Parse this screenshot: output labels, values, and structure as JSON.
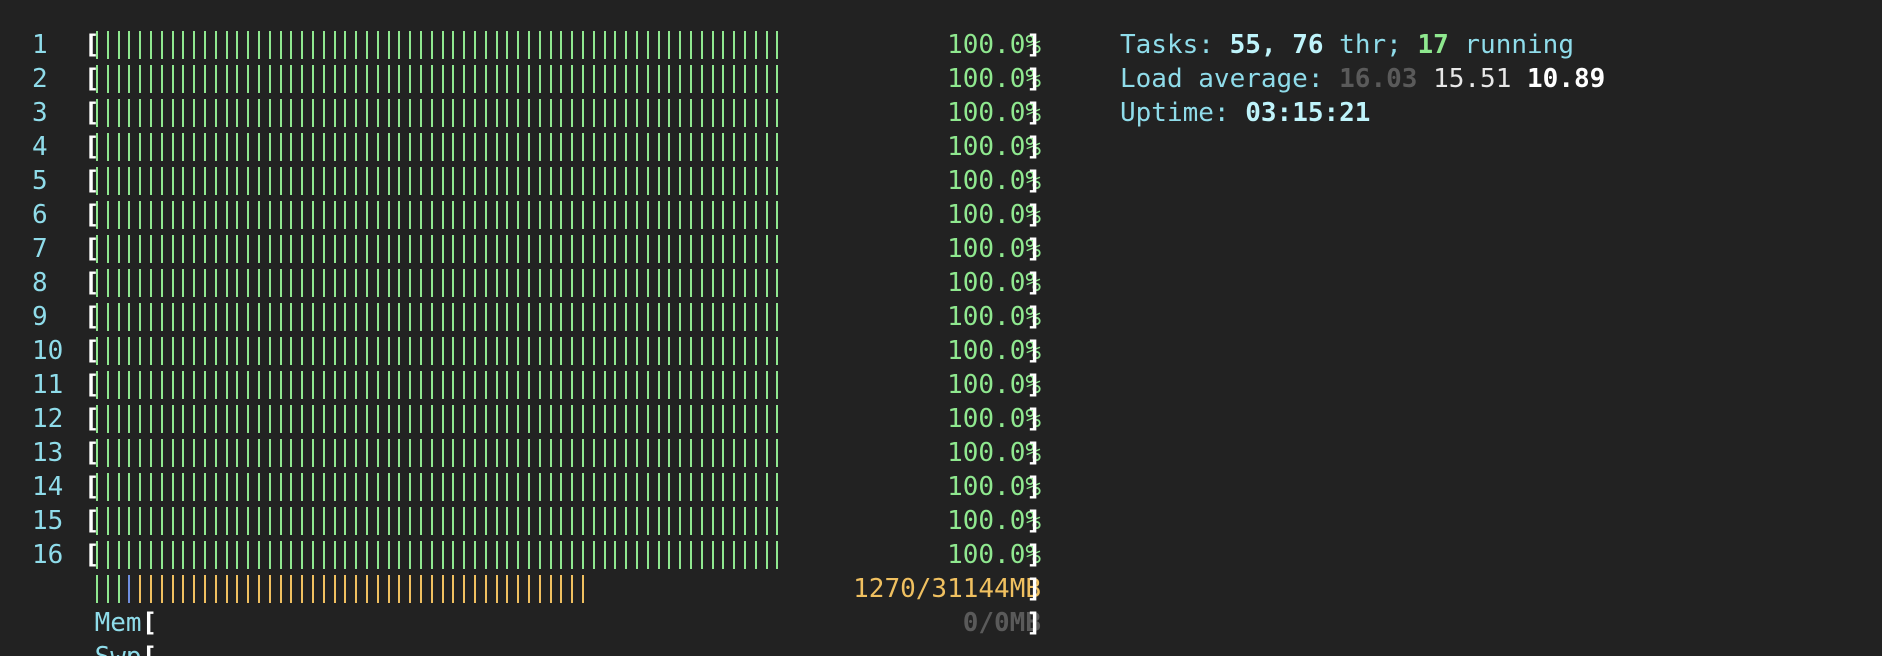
{
  "colors": {
    "background": "#222222",
    "label": "#8fdcea",
    "cpu_bar": "#8fe88f",
    "mem_used": "#8fe88f",
    "mem_buffers": "#6f8fe0",
    "mem_cache": "#f0c060",
    "swap_text": "#5a5a5a"
  },
  "cpus": [
    {
      "label": "1",
      "usage_text": "100.0%",
      "usage_percent": 100
    },
    {
      "label": "2",
      "usage_text": "100.0%",
      "usage_percent": 100
    },
    {
      "label": "3",
      "usage_text": "100.0%",
      "usage_percent": 100
    },
    {
      "label": "4",
      "usage_text": "100.0%",
      "usage_percent": 100
    },
    {
      "label": "5",
      "usage_text": "100.0%",
      "usage_percent": 100
    },
    {
      "label": "6",
      "usage_text": "100.0%",
      "usage_percent": 100
    },
    {
      "label": "7",
      "usage_text": "100.0%",
      "usage_percent": 100
    },
    {
      "label": "8",
      "usage_text": "100.0%",
      "usage_percent": 100
    },
    {
      "label": "9",
      "usage_text": "100.0%",
      "usage_percent": 100
    },
    {
      "label": "10",
      "usage_text": "100.0%",
      "usage_percent": 100
    },
    {
      "label": "11",
      "usage_text": "100.0%",
      "usage_percent": 100
    },
    {
      "label": "12",
      "usage_text": "100.0%",
      "usage_percent": 100
    },
    {
      "label": "13",
      "usage_text": "100.0%",
      "usage_percent": 100
    },
    {
      "label": "14",
      "usage_text": "100.0%",
      "usage_percent": 100
    },
    {
      "label": "15",
      "usage_text": "100.0%",
      "usage_percent": 100
    },
    {
      "label": "16",
      "usage_text": "100.0%",
      "usage_percent": 100
    }
  ],
  "mem": {
    "label": "Mem",
    "value_text": "1270/31144MB",
    "used_ticks": 3,
    "buffer_ticks": 1,
    "cache_ticks": 42
  },
  "swap": {
    "label": "Swp",
    "value_text": "0/0MB"
  },
  "tasks": {
    "prefix": "Tasks: ",
    "count": "55",
    "sep": ", ",
    "threads": "76",
    "thr_label": " thr; ",
    "running": "17",
    "running_label": " running"
  },
  "load": {
    "prefix": "Load average: ",
    "one": "16.03",
    "five": "15.51",
    "fifteen": "10.89"
  },
  "uptime": {
    "prefix": "Uptime: ",
    "value": "03:15:21"
  }
}
